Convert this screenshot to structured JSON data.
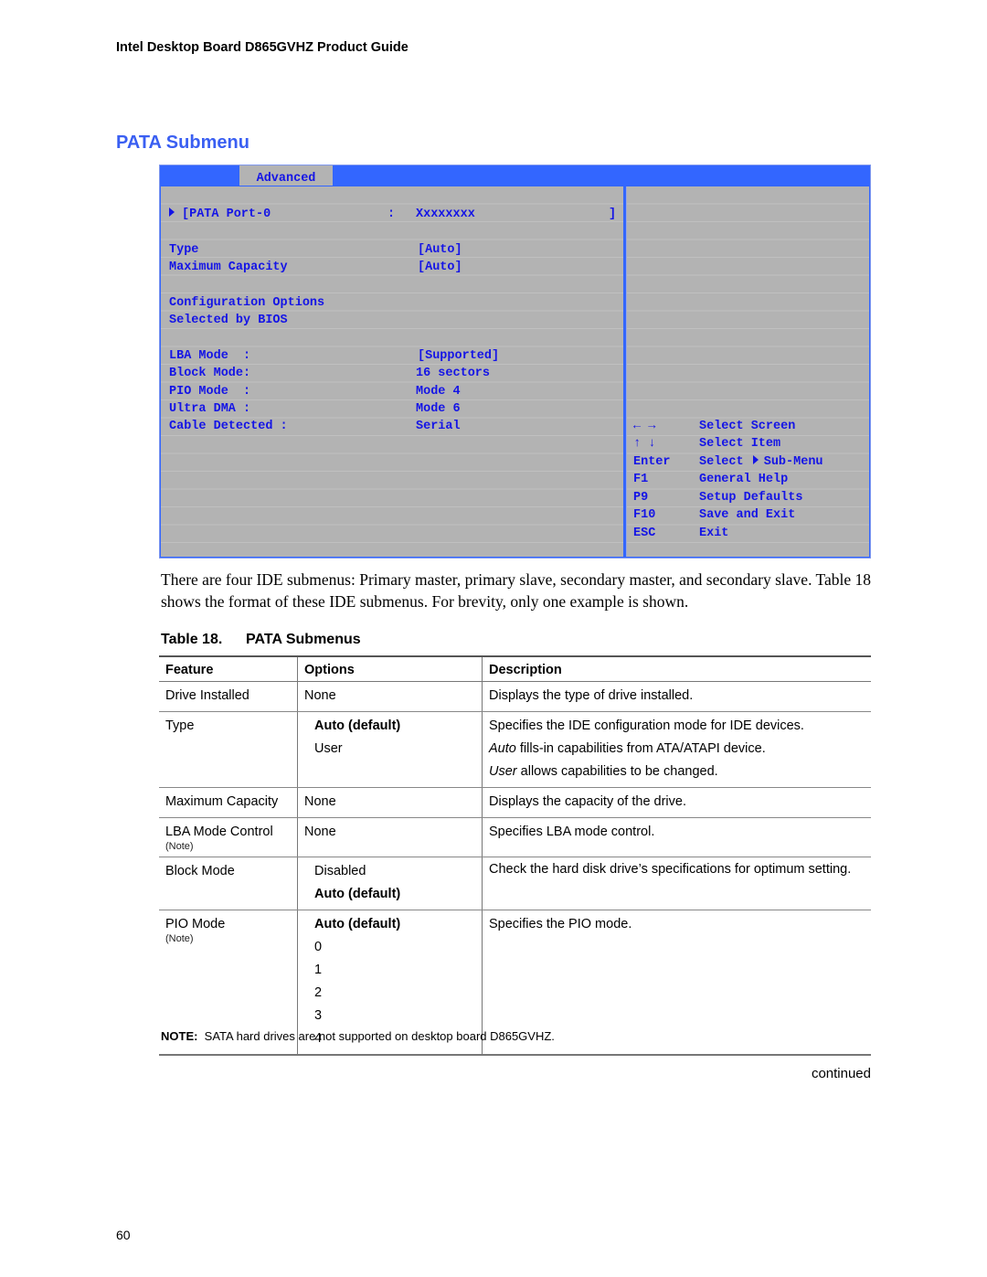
{
  "running_header": "Intel Desktop Board D865GVHZ Product Guide",
  "section_title": "PATA Submenu",
  "bios": {
    "active_tab": "Advanced",
    "colors": {
      "frame": "#3366ff",
      "panel": "#b3b3b3",
      "text": "#1414e6"
    },
    "port_line": {
      "label": "[PATA Port-0",
      "sep": ":",
      "value": "Xxxxxxxx",
      "close": "]"
    },
    "settings": [
      {
        "label": "Type",
        "value": "[Auto]"
      },
      {
        "label": "Maximum Capacity",
        "value": "[Auto]"
      }
    ],
    "config_heading": [
      "Configuration Options",
      "Selected by BIOS"
    ],
    "info": [
      {
        "label": "LBA Mode  :",
        "value": "[Supported]"
      },
      {
        "label": "Block Mode:",
        "value": "16 sectors"
      },
      {
        "label": "PIO Mode  :",
        "value": "Mode 4"
      },
      {
        "label": "Ultra DMA :",
        "value": "Mode 6"
      },
      {
        "label": "Cable Detected :",
        "value": "Serial"
      }
    ],
    "help": [
      {
        "key": "← →",
        "desc": "Select Screen"
      },
      {
        "key": "↑ ↓",
        "desc": "Select Item"
      },
      {
        "key": "Enter",
        "desc_pre": "Select",
        "desc_post": "Sub-Menu"
      },
      {
        "key": "F1",
        "desc": "General Help"
      },
      {
        "key": "P9",
        "desc": "Setup Defaults"
      },
      {
        "key": "F10",
        "desc": "Save and Exit"
      },
      {
        "key": "ESC",
        "desc": "Exit"
      }
    ]
  },
  "body_text": "There are four IDE submenus:  Primary master, primary slave, secondary master, and secondary slave.  Table 18 shows the format of these IDE submenus.  For brevity, only one example is shown.",
  "table": {
    "caption_number": "Table 18.",
    "caption_title": "PATA Submenus",
    "headers": [
      "Feature",
      "Options",
      "Description"
    ],
    "rows": [
      {
        "feature": "Drive Installed",
        "options": [
          "None"
        ],
        "description": [
          "Displays the type of drive installed."
        ]
      },
      {
        "feature": "Type",
        "options": [
          "Auto (default)",
          "User"
        ],
        "description": [
          "Specifies the IDE configuration mode for IDE devices.",
          {
            "em": "Auto",
            "rest": " fills-in capabilities from ATA/ATAPI device."
          },
          {
            "em": "User",
            "rest": " allows capabilities to be changed."
          }
        ]
      },
      {
        "feature": "Maximum Capacity",
        "options": [
          "None"
        ],
        "description": [
          "Displays the capacity of the drive."
        ]
      },
      {
        "feature": "LBA Mode Control",
        "note": "(Note)",
        "options": [
          "None"
        ],
        "description": [
          "Specifies LBA mode control."
        ]
      },
      {
        "feature": "Block Mode",
        "options": [
          "Disabled",
          "Auto (default)"
        ],
        "description": [
          "Check the hard disk drive’s specifications for optimum setting."
        ]
      },
      {
        "feature": "PIO Mode",
        "note": "(Note)",
        "options": [
          "Auto (default)",
          "0",
          "1",
          "2",
          "3",
          "4"
        ],
        "description": [
          "Specifies the PIO mode."
        ]
      }
    ]
  },
  "footnote": {
    "label": "NOTE:",
    "text": "  SATA hard drives are not supported on desktop board D865GVHZ."
  },
  "continued": "continued",
  "page_number": "60"
}
